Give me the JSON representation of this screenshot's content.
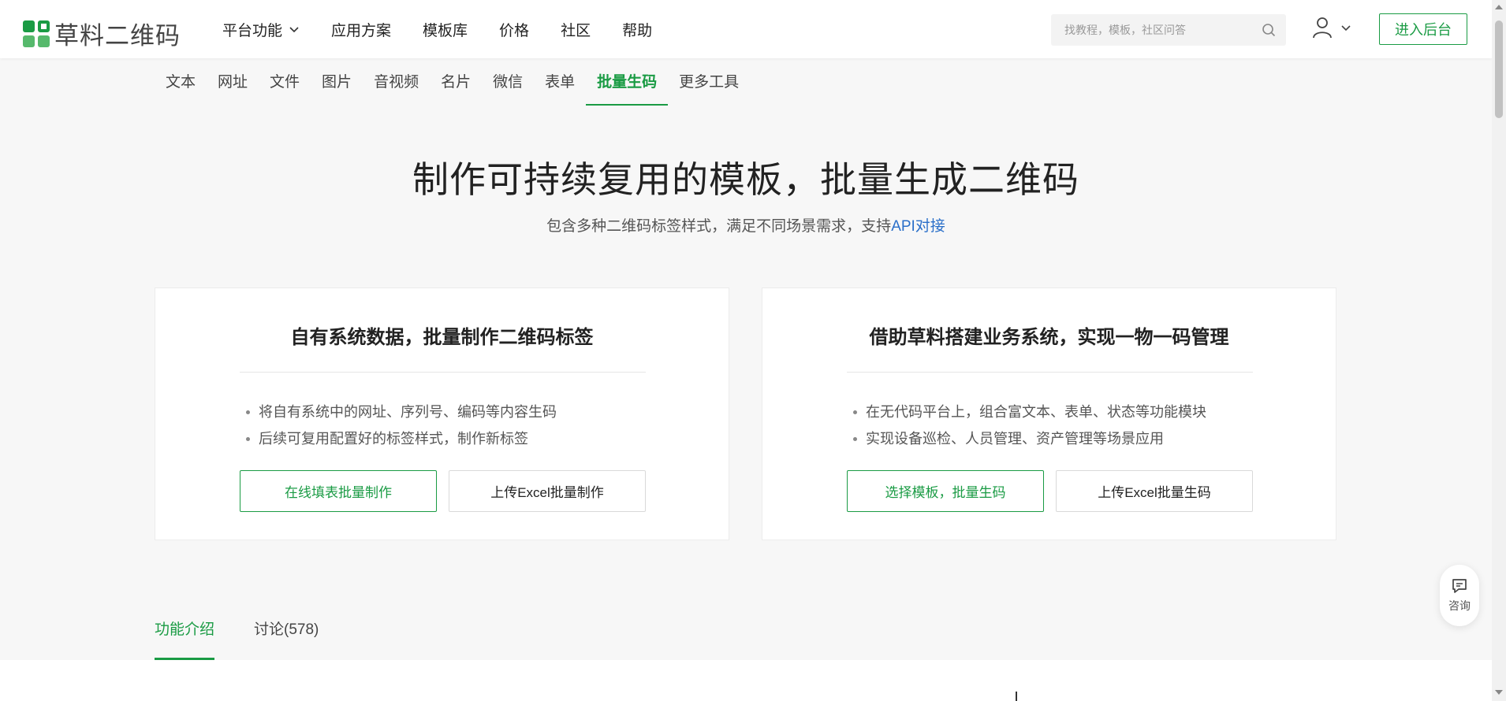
{
  "brand": {
    "name": "草料二维码",
    "color": "#1a9b44",
    "link_color": "#2a6fc9"
  },
  "nav": {
    "items": [
      {
        "label": "平台功能",
        "has_dropdown": true
      },
      {
        "label": "应用方案"
      },
      {
        "label": "模板库"
      },
      {
        "label": "价格"
      },
      {
        "label": "社区"
      },
      {
        "label": "帮助"
      }
    ]
  },
  "search": {
    "placeholder": "找教程，模板，社区问答",
    "icon": "search-icon"
  },
  "user": {
    "icon": "user-icon"
  },
  "header": {
    "console_button": "进入后台"
  },
  "subtabs": {
    "items": [
      "文本",
      "网址",
      "文件",
      "图片",
      "音视频",
      "名片",
      "微信",
      "表单",
      "批量生码",
      "更多工具"
    ],
    "active": "批量生码"
  },
  "hero": {
    "title": "制作可持续复用的模板，批量生成二维码",
    "subtitle_text": "包含多种二维码标签样式，满足不同场景需求，支持",
    "subtitle_link": "API对接"
  },
  "cards": [
    {
      "title": "自有系统数据，批量制作二维码标签",
      "bullets": [
        "将自有系统中的网址、序列号、编码等内容生码",
        "后续可复用配置好的标签样式，制作新标签"
      ],
      "primary_button": "在线填表批量制作",
      "secondary_button": "上传Excel批量制作"
    },
    {
      "title": "借助草料搭建业务系统，实现一物一码管理",
      "bullets": [
        "在无代码平台上，组合富文本、表单、状态等功能模块",
        "实现设备巡检、人员管理、资产管理等场景应用"
      ],
      "primary_button": "选择模板，批量生码",
      "secondary_button": "上传Excel批量生码"
    }
  ],
  "bottom_tabs": {
    "items": [
      "功能介绍",
      "讨论(578)"
    ],
    "active": "功能介绍"
  },
  "consult": {
    "label": "咨询",
    "icon": "chat-icon"
  }
}
